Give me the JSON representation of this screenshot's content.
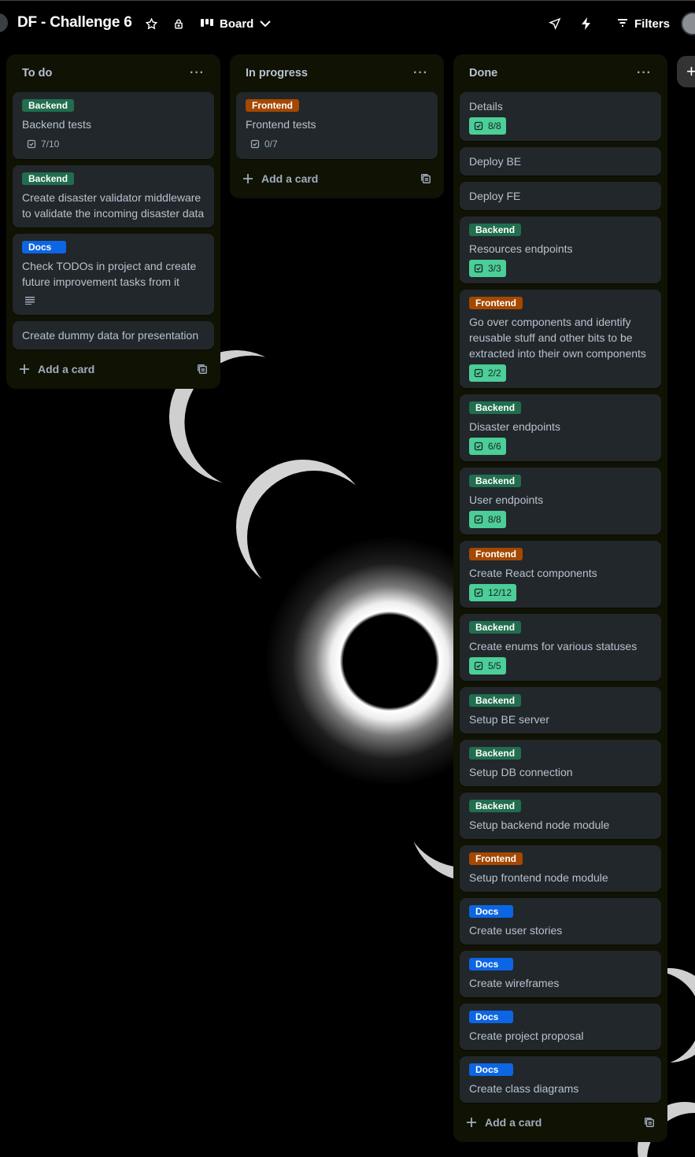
{
  "board": {
    "title": "DF - Challenge 6",
    "view_label": "Board",
    "filters_label": "Filters"
  },
  "icons": {
    "star": "star-icon",
    "visibility": "lock-icon",
    "board_view": "board-icon",
    "chevron": "chevron-down-icon",
    "share": "send-icon",
    "power_ups": "lightning-icon",
    "filter": "filter-icon",
    "checklist": "checklist-icon",
    "description": "description-icon",
    "plus": "plus-icon",
    "template": "template-icon",
    "more": "more-icon"
  },
  "colors": {
    "backend": "#216e4e",
    "frontend": "#a54800",
    "docs": "#0c66e4",
    "checklist_complete": "#4bce97",
    "list_bg": "#101204",
    "card_bg": "#22272b"
  },
  "lists": [
    {
      "title": "To do",
      "add_card": "Add a card",
      "cards": [
        {
          "label": "Backend",
          "title": "Backend tests",
          "checklist": "7/10"
        },
        {
          "label": "Backend",
          "title": "Create disaster validator middleware to validate the incoming disaster data"
        },
        {
          "label": "Docs",
          "title": "Check TODOs in project and create future improvement tasks from it"
        },
        {
          "title": "Create dummy data for presentation"
        }
      ]
    },
    {
      "title": "In progress",
      "add_card": "Add a card",
      "cards": [
        {
          "label": "Frontend",
          "title": "Frontend tests",
          "checklist": "0/7"
        }
      ]
    },
    {
      "title": "Done",
      "add_card": "Add a card",
      "cards": [
        {
          "title": "Details",
          "checklist": "8/8"
        },
        {
          "title": "Deploy BE"
        },
        {
          "title": "Deploy FE"
        },
        {
          "label": "Backend",
          "title": "Resources endpoints",
          "checklist": "3/3"
        },
        {
          "label": "Frontend",
          "title": "Go over components and identify reusable stuff and other bits to be extracted into their own components",
          "checklist": "2/2"
        },
        {
          "label": "Backend",
          "title": "Disaster endpoints",
          "checklist": "6/6"
        },
        {
          "label": "Backend",
          "title": "User endpoints",
          "checklist": "8/8"
        },
        {
          "label": "Frontend",
          "title": "Create React components",
          "checklist": "12/12"
        },
        {
          "label": "Backend",
          "title": "Create enums for various statuses",
          "checklist": "5/5"
        },
        {
          "label": "Backend",
          "title": "Setup BE server"
        },
        {
          "label": "Backend",
          "title": "Setup DB connection"
        },
        {
          "label": "Backend",
          "title": "Setup backend node module"
        },
        {
          "label": "Frontend",
          "title": "Setup frontend node module"
        },
        {
          "label": "Docs",
          "title": "Create user stories"
        },
        {
          "label": "Docs",
          "title": "Create wireframes"
        },
        {
          "label": "Docs",
          "title": "Create project proposal"
        },
        {
          "label": "Docs",
          "title": "Create class diagrams"
        }
      ]
    }
  ]
}
